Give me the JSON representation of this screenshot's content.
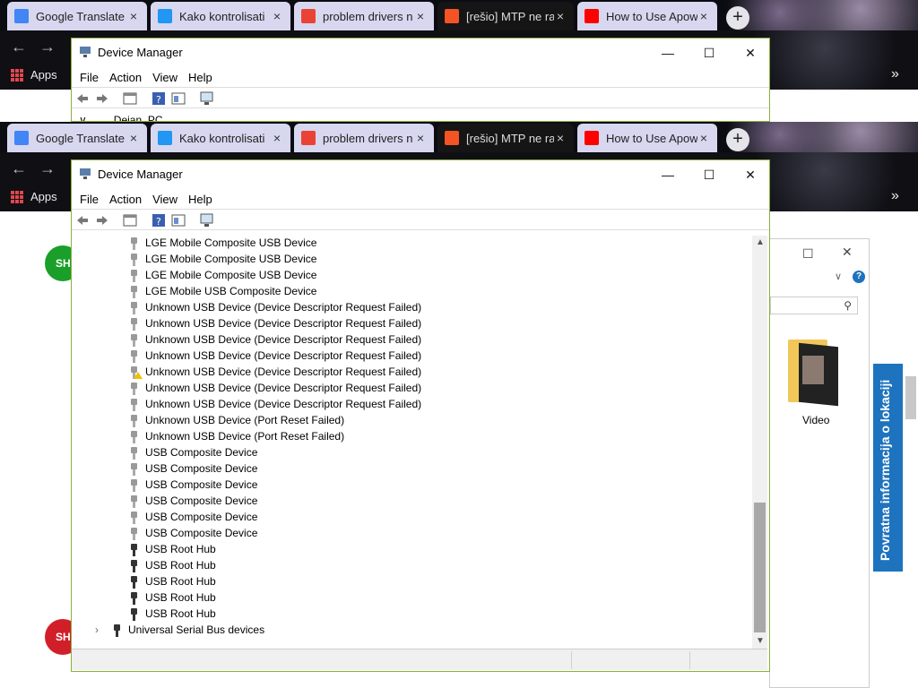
{
  "browser": {
    "tabs": [
      {
        "title": "Google Translate",
        "dark": false,
        "favicon_color": "#4285f4"
      },
      {
        "title": "Kako kontrolisati",
        "dark": false,
        "favicon_color": "#2196f3"
      },
      {
        "title": "problem drivers n",
        "dark": false,
        "favicon_color": "#ea4335"
      },
      {
        "title": "[rešio] MTP ne ra",
        "dark": true,
        "favicon_color": "#f35325"
      },
      {
        "title": "How to Use Apow",
        "dark": false,
        "favicon_color": "#ff0000"
      }
    ],
    "new_tab_label": "+",
    "close_label": "×",
    "apps_label": "Apps",
    "more_label": "»"
  },
  "window": {
    "title": "Device Manager",
    "minimize": "—",
    "maximize": "☐",
    "close": "✕",
    "menu": [
      "File",
      "Action",
      "View",
      "Help"
    ],
    "computer_node": "Dejan_PC"
  },
  "tree": {
    "rows": [
      {
        "label": "LGE Mobile Composite USB Device",
        "icon": "usb-device-icon",
        "warning": false
      },
      {
        "label": "LGE Mobile Composite USB Device",
        "icon": "usb-device-icon",
        "warning": false
      },
      {
        "label": "LGE Mobile Composite USB Device",
        "icon": "usb-device-icon",
        "warning": false
      },
      {
        "label": "LGE Mobile USB Composite Device",
        "icon": "usb-device-icon",
        "warning": false
      },
      {
        "label": "Unknown USB Device (Device Descriptor Request Failed)",
        "icon": "usb-device-icon",
        "warning": false
      },
      {
        "label": "Unknown USB Device (Device Descriptor Request Failed)",
        "icon": "usb-device-icon",
        "warning": false
      },
      {
        "label": "Unknown USB Device (Device Descriptor Request Failed)",
        "icon": "usb-device-icon",
        "warning": false
      },
      {
        "label": "Unknown USB Device (Device Descriptor Request Failed)",
        "icon": "usb-device-icon",
        "warning": false
      },
      {
        "label": "Unknown USB Device (Device Descriptor Request Failed)",
        "icon": "usb-device-icon",
        "warning": true
      },
      {
        "label": "Unknown USB Device (Device Descriptor Request Failed)",
        "icon": "usb-device-icon",
        "warning": false
      },
      {
        "label": "Unknown USB Device (Device Descriptor Request Failed)",
        "icon": "usb-device-icon",
        "warning": false
      },
      {
        "label": "Unknown USB Device (Port Reset Failed)",
        "icon": "usb-device-icon",
        "warning": false
      },
      {
        "label": "Unknown USB Device (Port Reset Failed)",
        "icon": "usb-device-icon",
        "warning": false
      },
      {
        "label": "USB Composite Device",
        "icon": "usb-device-icon",
        "warning": false
      },
      {
        "label": "USB Composite Device",
        "icon": "usb-device-icon",
        "warning": false
      },
      {
        "label": "USB Composite Device",
        "icon": "usb-device-icon",
        "warning": false
      },
      {
        "label": "USB Composite Device",
        "icon": "usb-device-icon",
        "warning": false
      },
      {
        "label": "USB Composite Device",
        "icon": "usb-device-icon",
        "warning": false
      },
      {
        "label": "USB Composite Device",
        "icon": "usb-device-icon",
        "warning": false
      },
      {
        "label": "USB Root Hub",
        "icon": "usb-hub-icon",
        "warning": false
      },
      {
        "label": "USB Root Hub",
        "icon": "usb-hub-icon",
        "warning": false
      },
      {
        "label": "USB Root Hub",
        "icon": "usb-hub-icon",
        "warning": false
      },
      {
        "label": "USB Root Hub",
        "icon": "usb-hub-icon",
        "warning": false
      },
      {
        "label": "USB Root Hub",
        "icon": "usb-hub-icon",
        "warning": false
      }
    ],
    "category": {
      "label": "Universal Serial Bus devices",
      "expand_glyph": "›"
    }
  },
  "background": {
    "circle_1": {
      "label": "SH",
      "color": "#1a9f2a"
    },
    "circle_2": {
      "label": "SH",
      "color": "#d11f2a"
    },
    "explorer_folder_label": "Video",
    "side_panel_label": "Povratna informacija o lokaciji"
  },
  "colors": {
    "window_border": "#8ab03c",
    "tab_active_bg": "#d7d7f0",
    "accent_blue": "#1e73be"
  }
}
